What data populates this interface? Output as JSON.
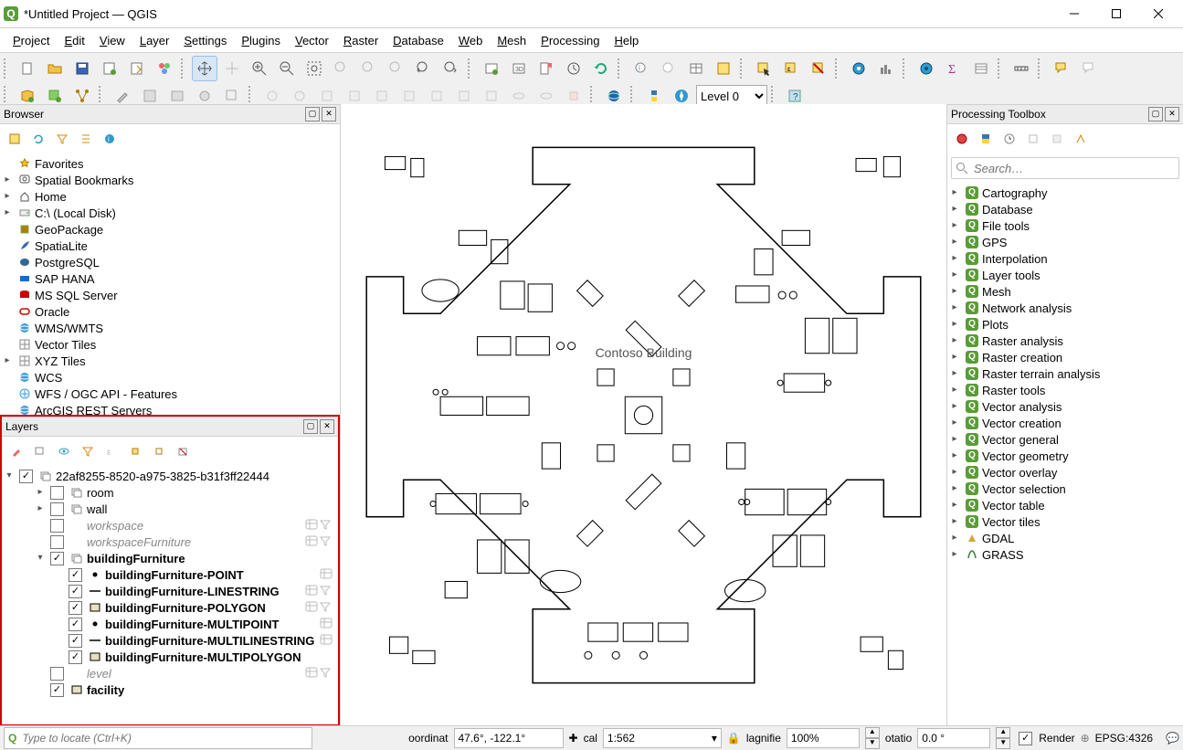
{
  "window": {
    "title": "*Untitled Project — QGIS"
  },
  "menu": [
    "Project",
    "Edit",
    "View",
    "Layer",
    "Settings",
    "Plugins",
    "Vector",
    "Raster",
    "Database",
    "Web",
    "Mesh",
    "Processing",
    "Help"
  ],
  "level_combo": "Level 0",
  "browser": {
    "title": "Browser",
    "items": [
      {
        "icon": "star",
        "label": "Favorites"
      },
      {
        "icon": "bookmark",
        "label": "Spatial Bookmarks",
        "expand": true
      },
      {
        "icon": "home",
        "label": "Home",
        "expand": true
      },
      {
        "icon": "disk",
        "label": "C:\\ (Local Disk)",
        "expand": true
      },
      {
        "icon": "gpkg",
        "label": "GeoPackage"
      },
      {
        "icon": "feather",
        "label": "SpatiaLite"
      },
      {
        "icon": "pg",
        "label": "PostgreSQL"
      },
      {
        "icon": "sap",
        "label": "SAP HANA"
      },
      {
        "icon": "mssql",
        "label": "MS SQL Server"
      },
      {
        "icon": "oracle",
        "label": "Oracle"
      },
      {
        "icon": "globe",
        "label": "WMS/WMTS"
      },
      {
        "icon": "grid",
        "label": "Vector Tiles"
      },
      {
        "icon": "grid",
        "label": "XYZ Tiles",
        "expand": true
      },
      {
        "icon": "globe",
        "label": "WCS"
      },
      {
        "icon": "wfs",
        "label": "WFS / OGC API - Features"
      },
      {
        "icon": "globe",
        "label": "ArcGIS REST Servers"
      }
    ]
  },
  "layers": {
    "title": "Layers",
    "root_checked": true,
    "root_label": "22af8255-8520-a975-3825-b31f3ff22444",
    "items": [
      {
        "indent": 1,
        "expand": "▸",
        "checked": false,
        "icon": "sheet",
        "label": "room",
        "bold": false
      },
      {
        "indent": 1,
        "expand": "▸",
        "checked": false,
        "icon": "sheet",
        "label": "wall",
        "bold": false
      },
      {
        "indent": 1,
        "expand": "",
        "checked": false,
        "icon": "",
        "label": "workspace",
        "muted": true,
        "tailFilter": true,
        "tailCount": true
      },
      {
        "indent": 1,
        "expand": "",
        "checked": false,
        "icon": "",
        "label": "workspaceFurniture",
        "muted": true,
        "tailFilter": true,
        "tailCount": true
      },
      {
        "indent": 1,
        "expand": "▾",
        "checked": true,
        "icon": "sheet",
        "label": "buildingFurniture",
        "bold": true
      },
      {
        "indent": 2,
        "expand": "",
        "checked": true,
        "sym": "dot",
        "label": "buildingFurniture-POINT",
        "bold": true,
        "tailCount": true
      },
      {
        "indent": 2,
        "expand": "",
        "checked": true,
        "sym": "line",
        "label": "buildingFurniture-LINESTRING",
        "bold": true,
        "tailFilter": true,
        "tailCount": true
      },
      {
        "indent": 2,
        "expand": "",
        "checked": true,
        "sym": "box",
        "label": "buildingFurniture-POLYGON",
        "bold": true,
        "tailFilter": true,
        "tailCount": true
      },
      {
        "indent": 2,
        "expand": "",
        "checked": true,
        "sym": "dot",
        "label": "buildingFurniture-MULTIPOINT",
        "bold": true,
        "tailCount": true
      },
      {
        "indent": 2,
        "expand": "",
        "checked": true,
        "sym": "line",
        "label": "buildingFurniture-MULTILINESTRING",
        "bold": true,
        "tailCount": true
      },
      {
        "indent": 2,
        "expand": "",
        "checked": true,
        "sym": "box",
        "label": "buildingFurniture-MULTIPOLYGON",
        "bold": true
      },
      {
        "indent": 1,
        "expand": "",
        "checked": false,
        "icon": "",
        "label": "level",
        "muted": true,
        "tailFilter": true,
        "tailCount": true
      },
      {
        "indent": 1,
        "expand": "",
        "checked": true,
        "icon": "box",
        "label": "facility",
        "bold": true
      }
    ]
  },
  "processing": {
    "title": "Processing Toolbox",
    "search_placeholder": "Search…",
    "groups": [
      "Cartography",
      "Database",
      "File tools",
      "GPS",
      "Interpolation",
      "Layer tools",
      "Mesh",
      "Network analysis",
      "Plots",
      "Raster analysis",
      "Raster creation",
      "Raster terrain analysis",
      "Raster tools",
      "Vector analysis",
      "Vector creation",
      "Vector general",
      "Vector geometry",
      "Vector overlay",
      "Vector selection",
      "Vector table",
      "Vector tiles"
    ],
    "extra": [
      {
        "label": "GDAL",
        "icon": "gdal"
      },
      {
        "label": "GRASS",
        "icon": "grass"
      }
    ]
  },
  "map": {
    "label": "Contoso Building"
  },
  "status": {
    "locator_placeholder": "Type to locate (Ctrl+K)",
    "coord_label": "oordinat",
    "coord_value": "47.6°, -122.1°",
    "scale_label": "cal",
    "scale_value": "1:562",
    "mag_label": "lagnifie",
    "mag_value": "100%",
    "rot_label": "otatio",
    "rot_value": "0.0 °",
    "render_label": "Render",
    "render_checked": true,
    "crs": "EPSG:4326"
  }
}
